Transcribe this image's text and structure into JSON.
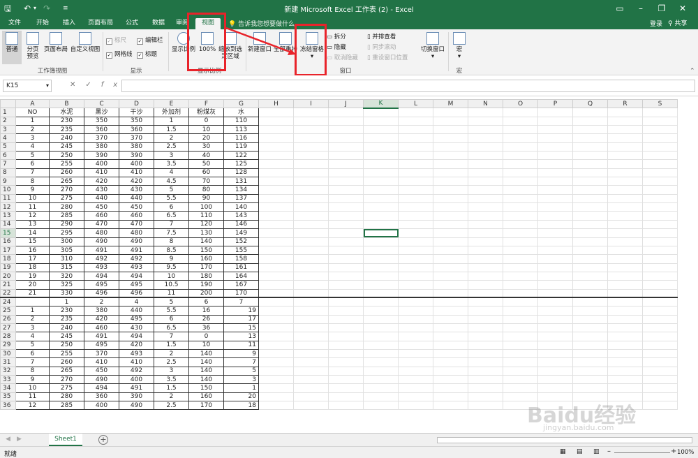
{
  "title": "新建 Microsoft Excel 工作表 (2) - Excel",
  "tabs": [
    "文件",
    "开始",
    "插入",
    "页面布局",
    "公式",
    "数据",
    "审阅",
    "视图"
  ],
  "active_tab": "视图",
  "tell_me": "告诉我您想要做什么...",
  "login": "登录",
  "share": "共享",
  "ribbon": {
    "views": {
      "normal": "普通",
      "page_break": "分页预览",
      "page_layout": "页面布局",
      "custom": "自定义视图",
      "group": "工作簿视图"
    },
    "show": {
      "ruler": "标尺",
      "formula_bar": "编辑栏",
      "gridlines": "网格线",
      "headings": "标题",
      "group": "显示"
    },
    "zoom": {
      "zoom": "显示比例",
      "p100": "100%",
      "to_sel": "缩放到选定区域",
      "group": "显示比例"
    },
    "window": {
      "new_window": "新建窗口",
      "arrange_all": "全部重排",
      "freeze": "冻结窗格",
      "split": "拆分",
      "hide": "隐藏",
      "unhide": "取消隐藏",
      "side_by_side": "并排查看",
      "sync_scroll": "同步滚动",
      "reset_pos": "重设窗口位置",
      "switch": "切换窗口",
      "group": "窗口"
    },
    "macros": {
      "macro": "宏",
      "group": "宏"
    }
  },
  "name_box": "K15",
  "col_headers": [
    "A",
    "B",
    "C",
    "D",
    "E",
    "F",
    "G",
    "H",
    "I",
    "J",
    "K",
    "L",
    "M",
    "N",
    "O",
    "P",
    "Q",
    "R",
    "S"
  ],
  "top_header_row": [
    "NO",
    "水泥",
    "黑沙",
    "干沙",
    "外加剂",
    "粉煤灰",
    "水"
  ],
  "top_rows": [
    [
      "1",
      "230",
      "350",
      "350",
      "1",
      "0",
      "110"
    ],
    [
      "2",
      "235",
      "360",
      "360",
      "1.5",
      "10",
      "113"
    ],
    [
      "3",
      "240",
      "370",
      "370",
      "2",
      "20",
      "116"
    ],
    [
      "4",
      "245",
      "380",
      "380",
      "2.5",
      "30",
      "119"
    ],
    [
      "5",
      "250",
      "390",
      "390",
      "3",
      "40",
      "122"
    ],
    [
      "6",
      "255",
      "400",
      "400",
      "3.5",
      "50",
      "125"
    ],
    [
      "7",
      "260",
      "410",
      "410",
      "4",
      "60",
      "128"
    ],
    [
      "8",
      "265",
      "420",
      "420",
      "4.5",
      "70",
      "131"
    ],
    [
      "9",
      "270",
      "430",
      "430",
      "5",
      "80",
      "134"
    ],
    [
      "10",
      "275",
      "440",
      "440",
      "5.5",
      "90",
      "137"
    ],
    [
      "11",
      "280",
      "450",
      "450",
      "6",
      "100",
      "140"
    ],
    [
      "12",
      "285",
      "460",
      "460",
      "6.5",
      "110",
      "143"
    ],
    [
      "13",
      "290",
      "470",
      "470",
      "7",
      "120",
      "146"
    ],
    [
      "14",
      "295",
      "480",
      "480",
      "7.5",
      "130",
      "149"
    ],
    [
      "15",
      "300",
      "490",
      "490",
      "8",
      "140",
      "152"
    ],
    [
      "16",
      "305",
      "491",
      "491",
      "8.5",
      "150",
      "155"
    ],
    [
      "17",
      "310",
      "492",
      "492",
      "9",
      "160",
      "158"
    ],
    [
      "18",
      "315",
      "493",
      "493",
      "9.5",
      "170",
      "161"
    ],
    [
      "19",
      "320",
      "494",
      "494",
      "10",
      "180",
      "164"
    ],
    [
      "20",
      "325",
      "495",
      "495",
      "10.5",
      "190",
      "167"
    ],
    [
      "21",
      "330",
      "496",
      "496",
      "11",
      "200",
      "170"
    ]
  ],
  "row24": [
    "",
    "1",
    "2",
    "4",
    "5",
    "6",
    "7"
  ],
  "bottom_rows": [
    [
      "1",
      "230",
      "380",
      "440",
      "5.5",
      "16",
      "19"
    ],
    [
      "2",
      "235",
      "420",
      "495",
      "6",
      "26",
      "17"
    ],
    [
      "3",
      "240",
      "460",
      "430",
      "6.5",
      "36",
      "15"
    ],
    [
      "4",
      "245",
      "491",
      "494",
      "7",
      "0",
      "13"
    ],
    [
      "5",
      "250",
      "495",
      "420",
      "1.5",
      "10",
      "11"
    ],
    [
      "6",
      "255",
      "370",
      "493",
      "2",
      "140",
      "9"
    ],
    [
      "7",
      "260",
      "410",
      "410",
      "2.5",
      "140",
      "7"
    ],
    [
      "8",
      "265",
      "450",
      "492",
      "3",
      "140",
      "5"
    ],
    [
      "9",
      "270",
      "490",
      "400",
      "3.5",
      "140",
      "3"
    ],
    [
      "10",
      "275",
      "494",
      "491",
      "1.5",
      "150",
      "1"
    ],
    [
      "11",
      "280",
      "360",
      "390",
      "2",
      "160",
      "20"
    ],
    [
      "12",
      "285",
      "400",
      "490",
      "2.5",
      "170",
      "18"
    ]
  ],
  "sheet_tab": "Sheet1",
  "status": "就绪",
  "zoom_level": "100%",
  "watermark": "Baidu经验",
  "watermark_sub": "jingyan.baidu.com"
}
